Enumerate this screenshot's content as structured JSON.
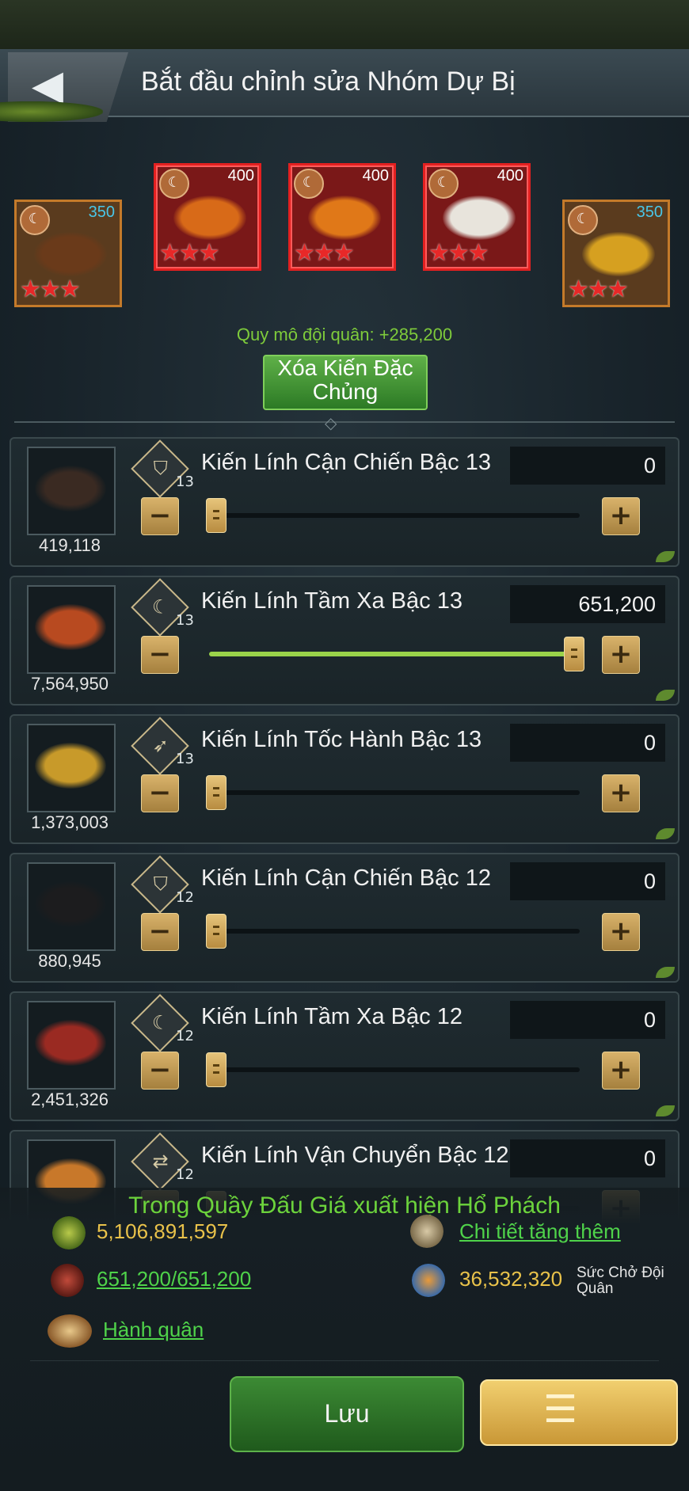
{
  "header": {
    "title": "Bắt đầu chỉnh sửa Nhóm Dự Bị"
  },
  "special_ants": [
    {
      "cost": "350",
      "stars": "★★★",
      "frame": "gold",
      "color": "#6a3a1a"
    },
    {
      "cost": "400",
      "stars": "★★★",
      "frame": "red",
      "color": "#d86a18"
    },
    {
      "cost": "400",
      "stars": "★★★",
      "frame": "red",
      "color": "#e07818"
    },
    {
      "cost": "400",
      "stars": "★★★",
      "frame": "red",
      "color": "#e8e4dc"
    },
    {
      "cost": "350",
      "stars": "★★★",
      "frame": "gold",
      "color": "#d6a020"
    }
  ],
  "army_scale": "Quy mô đội quân: +285,200",
  "clear_button": "Xóa Kiến Đặc Chủng",
  "troops": [
    {
      "name": "Kiến Lính Cận Chiến Bậc 13",
      "tier": "13",
      "available": "419,118",
      "value": "0",
      "fill": 0,
      "icon": "shield-icon",
      "glyph": "⛉",
      "color": "#3a2a22"
    },
    {
      "name": "Kiến Lính Tầm Xa Bậc 13",
      "tier": "13",
      "available": "7,564,950",
      "value": "651,200",
      "fill": 1,
      "icon": "bow-icon",
      "glyph": "☾",
      "color": "#b84a20"
    },
    {
      "name": "Kiến Lính Tốc Hành Bậc 13",
      "tier": "13",
      "available": "1,373,003",
      "value": "0",
      "fill": 0,
      "icon": "wing-icon",
      "glyph": "➶",
      "color": "#c89a2a"
    },
    {
      "name": "Kiến Lính Cận Chiến Bậc 12",
      "tier": "12",
      "available": "880,945",
      "value": "0",
      "fill": 0,
      "icon": "shield-icon",
      "glyph": "⛉",
      "color": "#1c1c1e"
    },
    {
      "name": "Kiến Lính Tầm Xa Bậc 12",
      "tier": "12",
      "available": "2,451,326",
      "value": "0",
      "fill": 0,
      "icon": "bow-icon",
      "glyph": "☾",
      "color": "#9a2a22"
    },
    {
      "name": "Kiến Lính Vận Chuyển Bậc 12",
      "tier": "12",
      "available": "",
      "value": "0",
      "fill": 0,
      "icon": "transport-icon",
      "glyph": "⇄",
      "color": "#c8782a"
    }
  ],
  "marquee": "Trong Quầy Đấu Giá xuất hiện Hổ Phách",
  "stats": {
    "power": "5,106,891,597",
    "details_link": "Chi tiết tăng thêm",
    "troops": "651,200/651,200",
    "load": "36,532,320",
    "load_label": "Sức Chở Đội Quân",
    "march": "Hành quân"
  },
  "save_button": "Lưu"
}
